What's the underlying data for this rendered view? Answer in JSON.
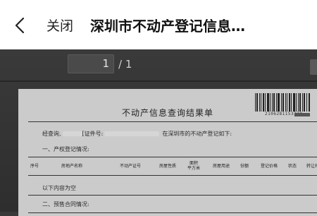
{
  "header": {
    "back_icon": "chevron-left-icon",
    "close_label": "关闭",
    "title": "深圳市不动产登记信息…"
  },
  "viewer": {
    "page_current": "1",
    "page_total": "/ 1"
  },
  "document": {
    "title": "不动产信息查询结果单",
    "barcode_number": "2106281153328",
    "query_prefix": "经查询,",
    "cert_label": "[证件号:",
    "query_suffix": "在深圳市的不动产登记如下:",
    "section1": "一、产权登记情况:",
    "table_headers": [
      "序号",
      "房地产名称",
      "不动产证号",
      "房屋性质",
      "面积\n平方米",
      "房屋用途",
      "份额",
      "登记价格",
      "状态",
      "转让时间"
    ],
    "empty_text": "以下内容为空",
    "section2": "二、预售合同情况:"
  },
  "colors": {
    "header_bg": "#ffffff",
    "viewer_bg": "#3a3a3a",
    "paper_bg": "#cbcbcb"
  }
}
